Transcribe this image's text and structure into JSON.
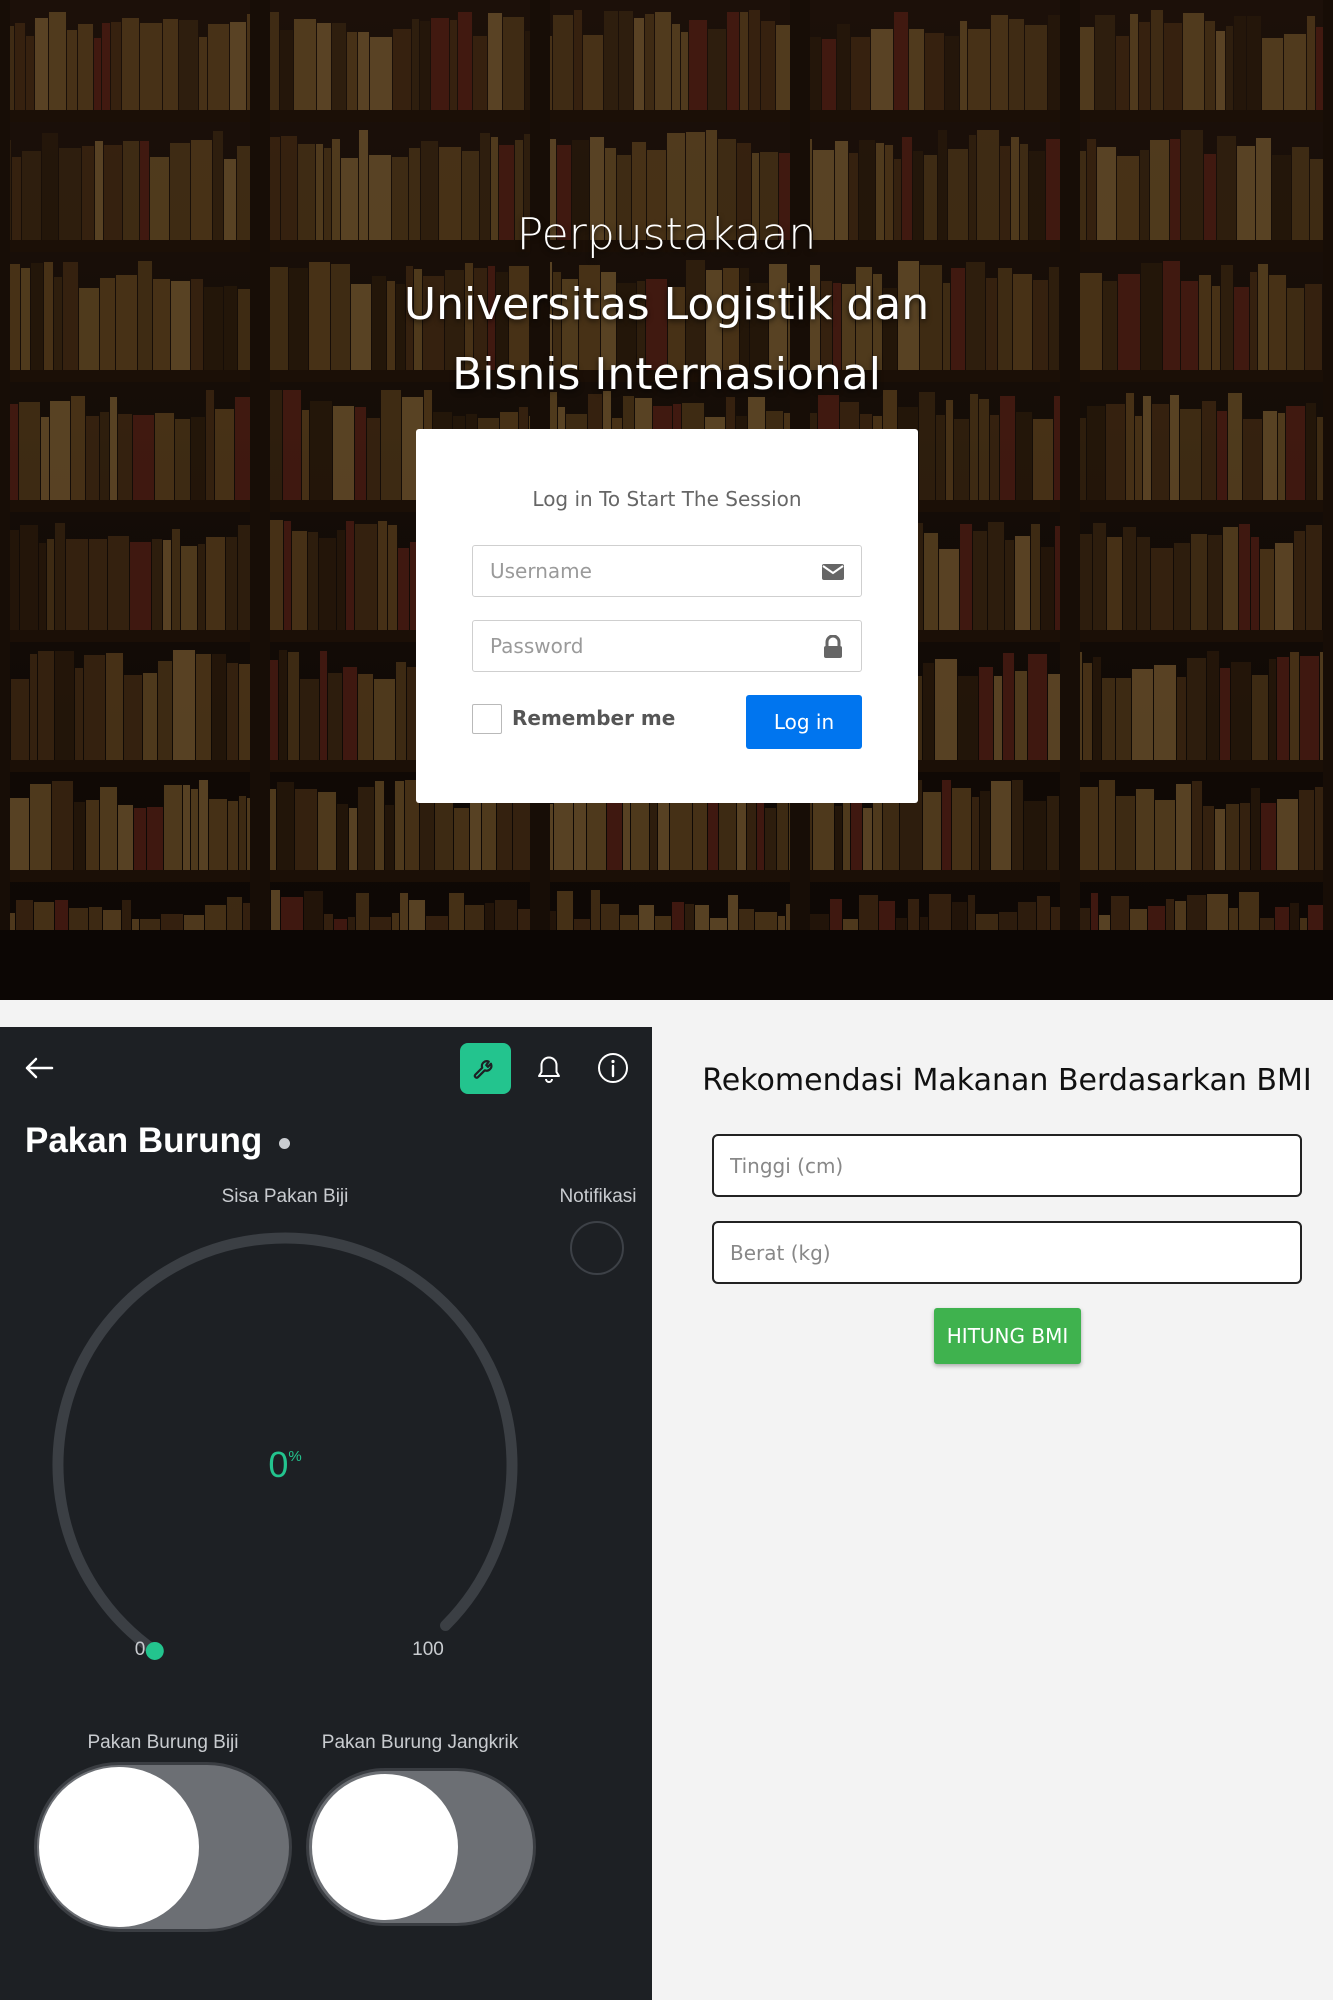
{
  "library": {
    "title_line1": "Perpustakaan",
    "title_line2": "Universitas Logistik dan",
    "title_line3": "Bisnis Internasional",
    "login": {
      "heading": "Log in To Start The Session",
      "username_placeholder": "Username",
      "password_placeholder": "Password",
      "remember_label": "Remember me",
      "login_button": "Log in",
      "remember_checked": false,
      "button_color": "#0075ef"
    },
    "icons": [
      "envelope-icon",
      "lock-icon"
    ]
  },
  "iot": {
    "device_title": "Pakan Burung",
    "header_icons": [
      "back-arrow-icon",
      "wrench-icon",
      "bell-icon",
      "info-icon"
    ],
    "accent_color": "#23c48e",
    "gauge": {
      "label": "Sisa Pakan Biji",
      "value": "0",
      "unit": "%",
      "min": "0",
      "max": "100"
    },
    "notification_label": "Notifikasi",
    "switches": [
      {
        "label": "Pakan Burung Biji",
        "on": false
      },
      {
        "label": "Pakan Burung Jangkrik",
        "on": false
      }
    ]
  },
  "bmi": {
    "title": "Rekomendasi Makanan Berdasarkan BMI",
    "height_placeholder": "Tinggi (cm)",
    "weight_placeholder": "Berat (kg)",
    "button": "HITUNG BMI",
    "button_color": "#3fb24e"
  }
}
